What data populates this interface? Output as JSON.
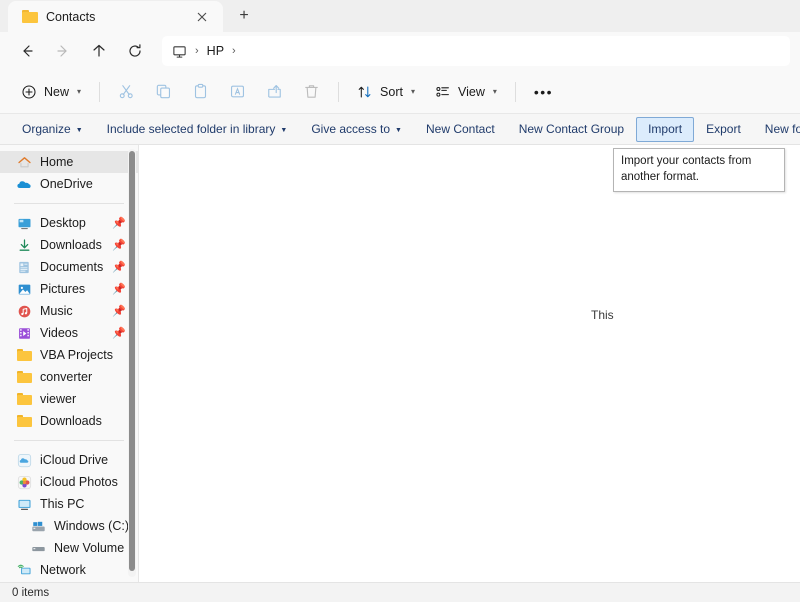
{
  "window": {
    "tab": {
      "title": "Contacts",
      "icon": "folder-icon",
      "close_icon": "close-icon"
    },
    "new_tab_label": "+"
  },
  "nav": {
    "back_icon": "arrow-left-icon",
    "forward_icon": "arrow-right-icon",
    "up_icon": "arrow-up-icon",
    "refresh_icon": "refresh-icon",
    "breadcrumb": {
      "root_icon": "this-pc-monitor-icon",
      "separator": "›",
      "items": [
        {
          "label": "HP"
        }
      ]
    }
  },
  "toolbar": {
    "new_label": "New",
    "new_icon": "plus-circle-icon",
    "cut_icon": "scissors-icon",
    "copy_icon": "copy-icon",
    "paste_icon": "paste-icon",
    "rename_icon": "rename-icon",
    "share_icon": "share-icon",
    "delete_icon": "trash-icon",
    "sort_label": "Sort",
    "sort_icon": "sort-arrows-icon",
    "view_label": "View",
    "view_icon": "view-list-icon",
    "more_label": "•••",
    "chevron": "⌄"
  },
  "commandbar": {
    "items": [
      {
        "label": "Organize",
        "has_caret": true,
        "state": "normal"
      },
      {
        "label": "Include selected folder in library",
        "has_caret": true,
        "state": "normal"
      },
      {
        "label": "Give access to",
        "has_caret": true,
        "state": "normal"
      },
      {
        "label": "New Contact",
        "has_caret": false,
        "state": "normal"
      },
      {
        "label": "New Contact Group",
        "has_caret": false,
        "state": "normal"
      },
      {
        "label": "Import",
        "has_caret": false,
        "state": "hover"
      },
      {
        "label": "Export",
        "has_caret": false,
        "state": "normal"
      },
      {
        "label": "New folder",
        "has_caret": false,
        "state": "normal"
      }
    ]
  },
  "tooltip": {
    "text": "Import your contacts from another format."
  },
  "sidebar": {
    "groups": [
      {
        "items": [
          {
            "label": "Home",
            "icon": "home-icon",
            "selected": true,
            "pinned": false,
            "indent": false
          },
          {
            "label": "OneDrive",
            "icon": "onedrive-cloud-icon",
            "selected": false,
            "pinned": false,
            "indent": false
          }
        ]
      },
      {
        "items": [
          {
            "label": "Desktop",
            "icon": "desktop-icon",
            "selected": false,
            "pinned": true,
            "indent": false
          },
          {
            "label": "Downloads",
            "icon": "downloads-arrow-icon",
            "selected": false,
            "pinned": true,
            "indent": false
          },
          {
            "label": "Documents",
            "icon": "documents-icon",
            "selected": false,
            "pinned": true,
            "indent": false
          },
          {
            "label": "Pictures",
            "icon": "pictures-icon",
            "selected": false,
            "pinned": true,
            "indent": false
          },
          {
            "label": "Music",
            "icon": "music-note-icon",
            "selected": false,
            "pinned": true,
            "indent": false
          },
          {
            "label": "Videos",
            "icon": "videos-film-icon",
            "selected": false,
            "pinned": true,
            "indent": false
          },
          {
            "label": "VBA Projects",
            "icon": "folder-icon",
            "selected": false,
            "pinned": false,
            "indent": false
          },
          {
            "label": "converter",
            "icon": "folder-icon",
            "selected": false,
            "pinned": false,
            "indent": false
          },
          {
            "label": "viewer",
            "icon": "folder-icon",
            "selected": false,
            "pinned": false,
            "indent": false
          },
          {
            "label": "Downloads",
            "icon": "folder-icon",
            "selected": false,
            "pinned": false,
            "indent": false
          }
        ]
      },
      {
        "items": [
          {
            "label": "iCloud Drive",
            "icon": "icloud-drive-icon",
            "selected": false,
            "pinned": false,
            "indent": false
          },
          {
            "label": "iCloud Photos",
            "icon": "icloud-photos-icon",
            "selected": false,
            "pinned": false,
            "indent": false
          },
          {
            "label": "This PC",
            "icon": "this-pc-monitor-icon",
            "selected": false,
            "pinned": false,
            "indent": false
          },
          {
            "label": "Windows (C:)",
            "icon": "windows-drive-icon",
            "selected": false,
            "pinned": false,
            "indent": true
          },
          {
            "label": "New Volume (D:",
            "icon": "drive-icon",
            "selected": false,
            "pinned": false,
            "indent": true
          },
          {
            "label": "Network",
            "icon": "network-icon",
            "selected": false,
            "pinned": false,
            "indent": false
          }
        ]
      }
    ]
  },
  "content": {
    "empty_message": "This"
  },
  "statusbar": {
    "item_count": "0 items"
  },
  "colors": {
    "accent_blue": "#0f6cbd",
    "command_text": "#203b6b",
    "hover_fill": "#dcecfc",
    "hover_border": "#7fa9d6",
    "selected_nav": "#e6e6e6",
    "folder_yellow": "#fcc53e",
    "window_bg": "#f9f9f9"
  }
}
